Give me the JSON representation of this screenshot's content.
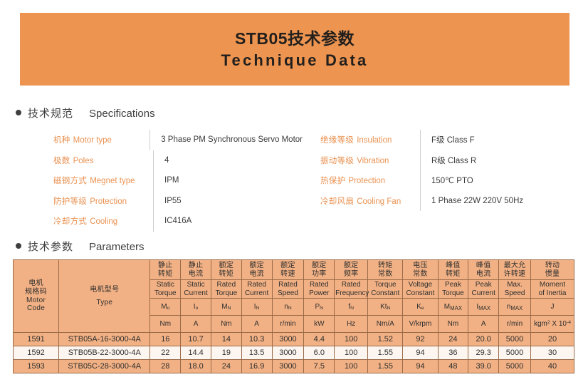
{
  "banner": {
    "title_cn": "STB05技术参数",
    "title_en": "Technique Data",
    "color_start": "#f3c39a",
    "color_end": "#ec9450"
  },
  "sections": {
    "specifications": {
      "cn": "技术规范",
      "en": "Specifications"
    },
    "parameters": {
      "cn": "技术参数",
      "en": "Parameters"
    }
  },
  "specs": {
    "left": [
      {
        "label_cn": "机种",
        "label_en": "Motor type",
        "value": "3 Phase PM Synchronous Servo Motor"
      },
      {
        "label_cn": "极数",
        "label_en": "Poles",
        "value": "4"
      },
      {
        "label_cn": "磁钢方式",
        "label_en": "Megnet type",
        "value": "IPM"
      },
      {
        "label_cn": "防护等级",
        "label_en": "Protection",
        "value": "IP55"
      },
      {
        "label_cn": "冷却方式",
        "label_en": "Cooling",
        "value": "IC416A"
      }
    ],
    "right": [
      {
        "label_cn": "绝缘等级",
        "label_en": "Insulation",
        "value": "F级  Class F"
      },
      {
        "label_cn": "振动等级",
        "label_en": "Vibration",
        "value": "R级  Class R"
      },
      {
        "label_cn": "热保护",
        "label_en": "Protection",
        "value": "150℃ PTO"
      },
      {
        "label_cn": "冷却风扇",
        "label_en": "Cooling Fan",
        "value": "1 Phase  22W  220V  50Hz"
      }
    ]
  },
  "table": {
    "corner": {
      "code_cn_1": "电机",
      "code_cn_2": "规格码",
      "code_en_1": "Motor",
      "code_en_2": "Code",
      "type_cn": "电机型号",
      "type_en": "Type"
    },
    "columns": [
      {
        "cn_1": "静止",
        "cn_2": "转矩",
        "en_1": "Static",
        "en_2": "Torque",
        "sym": "M",
        "sub": "o",
        "unit": "Nm"
      },
      {
        "cn_1": "静止",
        "cn_2": "电流",
        "en_1": "Static",
        "en_2": "Current",
        "sym": "I",
        "sub": "o",
        "unit": "A"
      },
      {
        "cn_1": "额定",
        "cn_2": "转矩",
        "en_1": "Rated",
        "en_2": "Torque",
        "sym": "M",
        "sub": "N",
        "unit": "Nm"
      },
      {
        "cn_1": "额定",
        "cn_2": "电流",
        "en_1": "Rated",
        "en_2": "Current",
        "sym": "I",
        "sub": "N",
        "unit": "A"
      },
      {
        "cn_1": "额定",
        "cn_2": "转速",
        "en_1": "Rated",
        "en_2": "Speed",
        "sym": "n",
        "sub": "N",
        "unit": "r/min"
      },
      {
        "cn_1": "额定",
        "cn_2": "功率",
        "en_1": "Rated",
        "en_2": "Power",
        "sym": "P",
        "sub": "N",
        "unit": "kW"
      },
      {
        "cn_1": "额定",
        "cn_2": "频率",
        "en_1": "Rated",
        "en_2": "Frequency",
        "sym": "f",
        "sub": "N",
        "unit": "Hz"
      },
      {
        "cn_1": "转矩",
        "cn_2": "常数",
        "en_1": "Torque",
        "en_2": "Constant",
        "sym": "Kt",
        "sub": "N",
        "unit": "Nm/A"
      },
      {
        "cn_1": "电压",
        "cn_2": "常数",
        "en_1": "Voltage",
        "en_2": "Constant",
        "sym": "K",
        "sub": "e",
        "unit": "V/krpm"
      },
      {
        "cn_1": "峰值",
        "cn_2": "转矩",
        "en_1": "Peak",
        "en_2": "Torque",
        "sym": "M",
        "sub": "MAX",
        "unit": "Nm"
      },
      {
        "cn_1": "峰值",
        "cn_2": "电流",
        "en_1": "Peak",
        "en_2": "Current",
        "sym": "I",
        "sub": "MAX",
        "unit": "A"
      },
      {
        "cn_1": "最大允",
        "cn_2": "许转速",
        "en_1": "Max.",
        "en_2": "Speed",
        "sym": "n",
        "sub": "MAX",
        "unit": "r/min"
      },
      {
        "cn_1": "转动",
        "cn_2": "惯量",
        "en_1": "Moment",
        "en_2": "of Inertia",
        "sym": "J",
        "sub": "",
        "unit": "kgm2 X 10-4"
      }
    ],
    "rows": [
      {
        "code": "1591",
        "type": "STB05A-16-3000-4A",
        "values": [
          "16",
          "10.7",
          "14",
          "10.3",
          "3000",
          "4.4",
          "100",
          "1.52",
          "92",
          "24",
          "20.0",
          "5000",
          "20"
        ]
      },
      {
        "code": "1592",
        "type": "STB05B-22-3000-4A",
        "values": [
          "22",
          "14.4",
          "19",
          "13.5",
          "3000",
          "6.0",
          "100",
          "1.55",
          "94",
          "36",
          "29.3",
          "5000",
          "30"
        ]
      },
      {
        "code": "1593",
        "type": "STB05C-28-3000-4A",
        "values": [
          "28",
          "18.0",
          "24",
          "16.9",
          "3000",
          "7.5",
          "100",
          "1.55",
          "94",
          "48",
          "39.0",
          "5000",
          "40"
        ]
      }
    ]
  }
}
